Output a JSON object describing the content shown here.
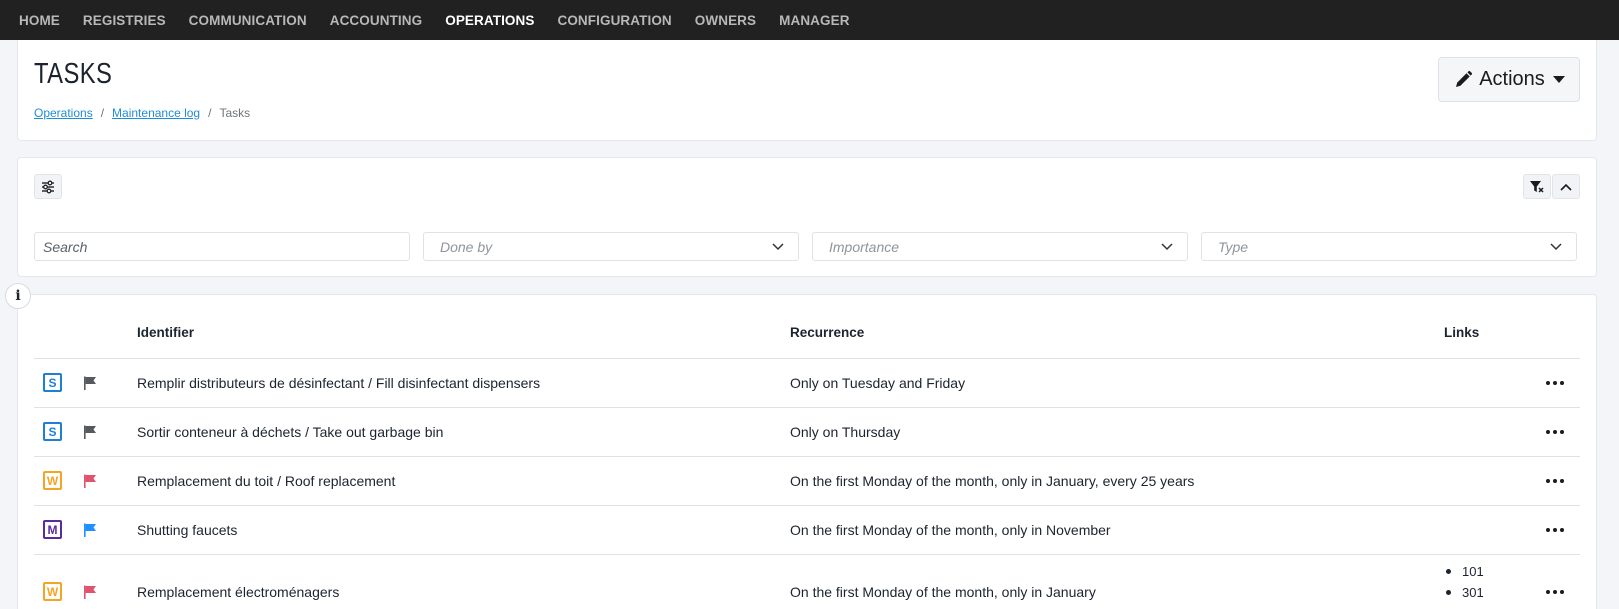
{
  "nav": {
    "items": [
      {
        "label": "HOME",
        "active": false
      },
      {
        "label": "REGISTRIES",
        "active": false
      },
      {
        "label": "COMMUNICATION",
        "active": false
      },
      {
        "label": "ACCOUNTING",
        "active": false
      },
      {
        "label": "OPERATIONS",
        "active": true
      },
      {
        "label": "CONFIGURATION",
        "active": false
      },
      {
        "label": "OWNERS",
        "active": false
      },
      {
        "label": "MANAGER",
        "active": false
      }
    ]
  },
  "header": {
    "title": "TASKS",
    "breadcrumb": [
      "Operations",
      "Maintenance log",
      "Tasks"
    ],
    "actions_label": "Actions",
    "actions_icon": "pencil-icon"
  },
  "filters": {
    "search_placeholder": "Search",
    "done_by_placeholder": "Done by",
    "importance_placeholder": "Importance",
    "type_placeholder": "Type"
  },
  "info_glyph": "i",
  "table": {
    "headers": {
      "identifier": "Identifier",
      "recurrence": "Recurrence",
      "links": "Links"
    },
    "rows": [
      {
        "type": "S",
        "type_color": "#1f7fd6",
        "flag_color": "#555a60",
        "identifier": "Remplir distributeurs de désinfectant / Fill disinfectant dispensers",
        "recurrence": "Only on Tuesday and Friday",
        "links": []
      },
      {
        "type": "S",
        "type_color": "#1f7fd6",
        "flag_color": "#555a60",
        "identifier": "Sortir conteneur à déchets / Take out garbage bin",
        "recurrence": "Only on Thursday",
        "links": []
      },
      {
        "type": "W",
        "type_color": "#f5a524",
        "flag_color": "#e0536d",
        "identifier": "Remplacement du toit / Roof replacement",
        "recurrence": "On the first Monday of the month, only in January, every 25 years",
        "links": []
      },
      {
        "type": "M",
        "type_color": "#5b2a9e",
        "flag_color": "#1e90ff",
        "identifier": "Shutting faucets",
        "recurrence": "On the first Monday of the month, only in November",
        "links": []
      },
      {
        "type": "W",
        "type_color": "#f5a524",
        "flag_color": "#e0536d",
        "identifier": "Remplacement électroménagers",
        "recurrence": "On the first Monday of the month, only in January",
        "links": [
          "101",
          "301"
        ]
      }
    ]
  }
}
